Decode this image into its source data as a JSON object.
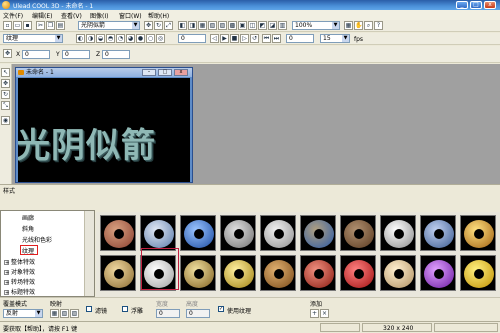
{
  "window": {
    "title": "Ulead COOL 3D - 未命名 - 1",
    "min": "_",
    "max": "□",
    "close": "x"
  },
  "menu": [
    "文件(F)",
    "编辑(E)",
    "查看(V)",
    "图像(I)",
    "窗口(W)",
    "帮助(H)"
  ],
  "toolbar1": {
    "text_select": "光阴似箭",
    "zoom": "100%"
  },
  "toolbar2": {
    "attr_select": "纹理",
    "field1": "0",
    "field2": "0",
    "field3": "15",
    "fps": "fps"
  },
  "toolbar3": {
    "x_label": "X",
    "x_value": "0",
    "y_label": "Y",
    "y_value": "0",
    "z_label": "Z",
    "z_value": "0"
  },
  "document": {
    "title": "未命名 - 1",
    "canvas_text": "光阴似箭"
  },
  "style_label": "样式",
  "tree": {
    "items": [
      {
        "label": "画廊",
        "indent": 2
      },
      {
        "label": "斜角",
        "indent": 2
      },
      {
        "label": "光线和色彩",
        "indent": 2
      },
      {
        "label": "纹理",
        "indent": 2
      },
      {
        "label": "整体特效",
        "indent": 1,
        "expander": "+"
      },
      {
        "label": "对象特效",
        "indent": 1,
        "expander": "+"
      },
      {
        "label": "转场特效",
        "indent": 1,
        "expander": "+"
      },
      {
        "label": "标题特效",
        "indent": 1,
        "expander": "+"
      }
    ]
  },
  "thumbnails": {
    "row1": [
      "brick",
      "blue-tile",
      "blue",
      "stone",
      "gray-cloud",
      "bluebrown",
      "brown-rock",
      "marble",
      "blue-stone",
      "gold-rock"
    ],
    "row2": [
      "tan",
      "white-swirl",
      "gold-wave",
      "gold",
      "wood",
      "red-brick",
      "red",
      "pale",
      "purple",
      "yellow"
    ]
  },
  "props": {
    "overlay_label": "覆盖模式",
    "overlay_value": "反射",
    "map_label": "映射",
    "filter_label": "滤镜",
    "relief_label": "浮雕",
    "width_label": "宽度",
    "width_value": "0",
    "height_label": "高度",
    "height_value": "0",
    "use_texture_label": "使用纹理",
    "use_texture_checked": "✓",
    "add_label": "添加"
  },
  "status": {
    "help": "要获取【帮助】，请按 F1 键",
    "size": "320 x 240"
  }
}
